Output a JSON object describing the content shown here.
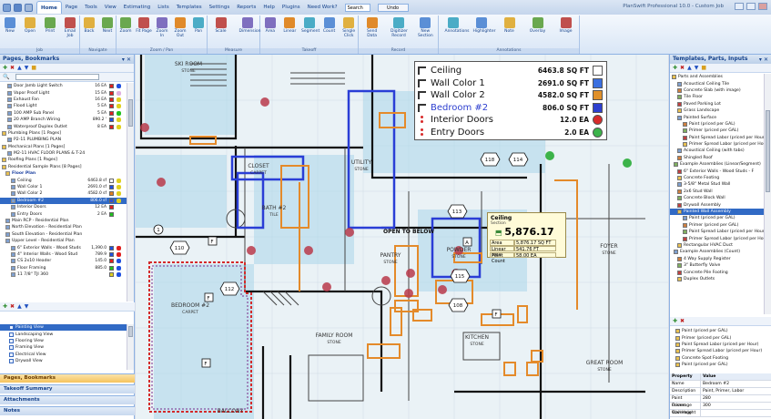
{
  "titlebar": {
    "menu_tabs": [
      "Home",
      "Page",
      "Tools",
      "View",
      "Estimating",
      "Lists",
      "Templates",
      "Settings",
      "Reports",
      "Help",
      "Plugins",
      "Need Work?"
    ],
    "search_placeholder": "Search",
    "undo_label": "Undo",
    "app_title": "PlanSwift Professional 10.0 - Custom Job"
  },
  "ribbon": {
    "groups": [
      {
        "label": "Job",
        "buttons": [
          "New",
          "Open",
          "Print",
          "Email Job"
        ]
      },
      {
        "label": "Navigate",
        "buttons": [
          "Back",
          "Next"
        ]
      },
      {
        "label": "Zoom / Pan",
        "buttons": [
          "Zoom",
          "Fit Page",
          "Zoom In",
          "Zoom Out",
          "Pan"
        ]
      },
      {
        "label": "Measure",
        "buttons": [
          "Scale",
          "Dimension"
        ]
      },
      {
        "label": "Takeoff",
        "buttons": [
          "Area",
          "Linear",
          "Segment",
          "Count",
          "Single Click"
        ]
      },
      {
        "label": "Record",
        "buttons": [
          "Send Data",
          "Digitizer Record",
          "New Section"
        ]
      },
      {
        "label": "Annotations",
        "buttons": [
          "Annotations",
          "Highlighter",
          "Note",
          "Overlay",
          "Image"
        ]
      }
    ]
  },
  "left_panel": {
    "title": "Pages, Bookmarks",
    "tree_top": [
      {
        "label": "Door Jamb Light Switch",
        "qty": "16 EA",
        "c1": "#e02020",
        "c2": "#2050e0"
      },
      {
        "label": "Vapor Proof Light",
        "qty": "15 EA",
        "c1": "#e02020",
        "c2": "#e0b0e0"
      },
      {
        "label": "Exhaust Fan",
        "qty": "16 EA",
        "c1": "#e02020",
        "c2": "#e0d020"
      },
      {
        "label": "Flood Light",
        "qty": "5 EA",
        "c1": "#e02020",
        "c2": "#e0d020"
      },
      {
        "label": "100 AMP Sub Panel",
        "qty": "5 EA",
        "c1": "#e02020",
        "c2": "#20c020"
      },
      {
        "label": "20 AMP Branch Wiring",
        "qty": "890.2 '",
        "c1": "#2050e0",
        "c2": "#e0d020"
      },
      {
        "label": "Waterproof Duplex Outlet",
        "qty": "8 EA",
        "c1": "#e02020",
        "c2": "#e0d020"
      },
      {
        "label": "Plumbing Plans [1 Pages]",
        "qty": "",
        "c1": "",
        "c2": ""
      },
      {
        "label": "P2-11 PLUMBING PLAN",
        "qty": "",
        "c1": "",
        "c2": ""
      },
      {
        "label": "Mechanical Plans [1 Pages]",
        "qty": "",
        "c1": "",
        "c2": ""
      },
      {
        "label": "M2-11 HVAC FLOOR PLANS & T-24",
        "qty": "",
        "c1": "",
        "c2": ""
      },
      {
        "label": "Roofing Plans [1 Pages]",
        "qty": "",
        "c1": "",
        "c2": ""
      },
      {
        "label": "Residential Sample Plans [8 Pages]",
        "qty": "",
        "c1": "",
        "c2": ""
      },
      {
        "label": "Floor Plan",
        "qty": "",
        "c1": "",
        "c2": ""
      },
      {
        "label": "Ceiling",
        "qty": "6463.8 sf",
        "c1": "#ffffff",
        "c2": "#e0d020"
      },
      {
        "label": "Wall Color 1",
        "qty": "2691.0 sf",
        "c1": "#2050e0",
        "c2": "#e0d020"
      },
      {
        "label": "Wall Color 2",
        "qty": "4582.0 sf",
        "c1": "#e08020",
        "c2": "#e0d020"
      },
      {
        "label": "Bedroom #2",
        "qty": "806.0 sf",
        "c1": "#3050d0",
        "c2": "#e0d020"
      },
      {
        "label": "Interior Doors",
        "qty": "12 EA",
        "c1": "#e02020",
        "c2": ""
      },
      {
        "label": "Entry Doors",
        "qty": "2 EA",
        "c1": "#20c020",
        "c2": ""
      },
      {
        "label": "Main RCP - Residential Plan",
        "qty": "",
        "c1": "",
        "c2": ""
      },
      {
        "label": "North Elevation - Residential Plan",
        "qty": "",
        "c1": "",
        "c2": ""
      },
      {
        "label": "South Elevation - Residential Plan",
        "qty": "",
        "c1": "",
        "c2": ""
      },
      {
        "label": "Upper Level - Residential Plan",
        "qty": "",
        "c1": "",
        "c2": ""
      },
      {
        "label": "6\" Exterior Walls - Wood Studs",
        "qty": "1,390.0",
        "c1": "#2050e0",
        "c2": "#e02020"
      },
      {
        "label": "4\" Interior Walls - Wood Stud",
        "qty": "789.9",
        "c1": "#2050e0",
        "c2": "#e02020"
      },
      {
        "label": "CS 2x10 Header",
        "qty": "145.0",
        "c1": "#e02020",
        "c2": "#2050e0"
      },
      {
        "label": "Floor Framing",
        "qty": "885.0",
        "c1": "#20c020",
        "c2": "#2050e0"
      },
      {
        "label": "11 7/8\" TJI 360",
        "qty": "",
        "c1": "#e0d020",
        "c2": "#2050e0"
      }
    ],
    "view_list": [
      "Painting View",
      "Landscaping View",
      "Flooring View",
      "Framing View",
      "Electrical View",
      "Drywall View"
    ],
    "accordions": [
      "Pages, Bookmarks",
      "Takeoff Summary",
      "Attachments",
      "Notes"
    ]
  },
  "legend": {
    "rows": [
      {
        "name": "Ceiling",
        "value": "6463.8 SQ FT",
        "color": "#ffffff",
        "name_color": "#111111"
      },
      {
        "name": "Wall Color 1",
        "value": "2691.0 SQ FT",
        "color": "#3b6fe0",
        "name_color": "#111111"
      },
      {
        "name": "Wall Color 2",
        "value": "4582.0 SQ FT",
        "color": "#e0902a",
        "name_color": "#111111"
      },
      {
        "name": "Bedroom #2",
        "value": "806.0 SQ FT",
        "color": "#2d3fcf",
        "name_color": "#2d3fcf"
      },
      {
        "name": "Interior Doors",
        "value": "12.0 EA",
        "color": "#d82a2a",
        "name_color": "#111111"
      },
      {
        "name": "Entry Doors",
        "value": "2.0 EA",
        "color": "#3cb34a",
        "name_color": "#111111"
      }
    ]
  },
  "tooltip": {
    "title": "Ceiling",
    "subtitle": "Section",
    "value": "5,876.17",
    "rows": [
      {
        "k": "Area",
        "v": "5,876.17 SQ FT"
      },
      {
        "k": "Linear Total",
        "v": "541.76 FT"
      },
      {
        "k": "Point Count",
        "v": "58.00 EA"
      }
    ]
  },
  "plan_labels": {
    "rooms": [
      {
        "name": "SKI ROOM",
        "sub": "STONE"
      },
      {
        "name": "CLOSET",
        "sub": "CARPET"
      },
      {
        "name": "BATH #2",
        "sub": "TILE"
      },
      {
        "name": "UTILITY",
        "sub": "STONE"
      },
      {
        "name": "BEDROOM #2",
        "sub": "CARPET"
      },
      {
        "name": "PANTRY",
        "sub": "STONE"
      },
      {
        "name": "POWDER",
        "sub": "STONE"
      },
      {
        "name": "FAMILY ROOM",
        "sub": "STONE"
      },
      {
        "name": "KITCHEN",
        "sub": "STONE"
      },
      {
        "name": "FOYER",
        "sub": "STONE"
      },
      {
        "name": "GREAT ROOM",
        "sub": "STONE"
      },
      {
        "name": "BALCONY",
        "sub": ""
      }
    ],
    "open_below": "OPEN TO BELOW",
    "tags": [
      "108",
      "110",
      "112",
      "113",
      "114",
      "115",
      "118",
      "1",
      "2",
      "3",
      "4",
      "F",
      "A",
      "F F"
    ]
  },
  "right_panel": {
    "title": "Templates, Parts, Inputs",
    "tree": [
      "Parts and Assemblies",
      "Acoustical Ceiling Tile",
      "Concrete Slab (with image)",
      "Tile Floor",
      "Paved Parking Lot",
      "Grass Landscape",
      "Painted Surface",
      "Paint (priced per GAL)",
      "Primer (priced per GAL)",
      "Paint Spread Labor (priced per Hour)",
      "Primer Spread Labor (priced per Hour)",
      "Acoustical Ceiling (with tabs)",
      "Shingled Roof",
      "Example Assemblies (Linear/Segment)",
      "6\" Exterior Walls - Wood Studs - F",
      "Concrete Footing",
      "3-5/8\" Metal Stud Wall",
      "2x6 Stud Wall",
      "Concrete Block Wall",
      "Drywall Assembly",
      "Painted Wall Assembly",
      "Paint (priced per GAL)",
      "Primer (priced per GAL)",
      "Paint Spread Labor (priced per Hour)",
      "Primer Spread Labor (priced per Hour)",
      "Rectangular HVAC Duct",
      "Example Assemblies (Count)",
      "4 Way Supply Register",
      "3\" Butterfly Valve",
      "Concrete Pile Footing",
      "Duplex Outlets"
    ],
    "lower_list": [
      "Paint (priced per GAL)",
      "Primer (priced per GAL)",
      "Paint Spread Labor (priced per Hour)",
      "Primer Spread Labor (priced per Hour)",
      "Concrete Spot Footing",
      "Paint (priced per GAL)"
    ],
    "props_header": {
      "k": "Property",
      "v": "Value"
    },
    "props": [
      {
        "k": "Name",
        "v": "Bedroom #2"
      },
      {
        "k": "Description",
        "v": "Paint, Primer, Labor"
      },
      {
        "k": "Paint Coverage",
        "v": "280"
      },
      {
        "k": "Primer Coverage",
        "v": "300"
      },
      {
        "k": "Wall Height",
        "v": ""
      }
    ]
  }
}
